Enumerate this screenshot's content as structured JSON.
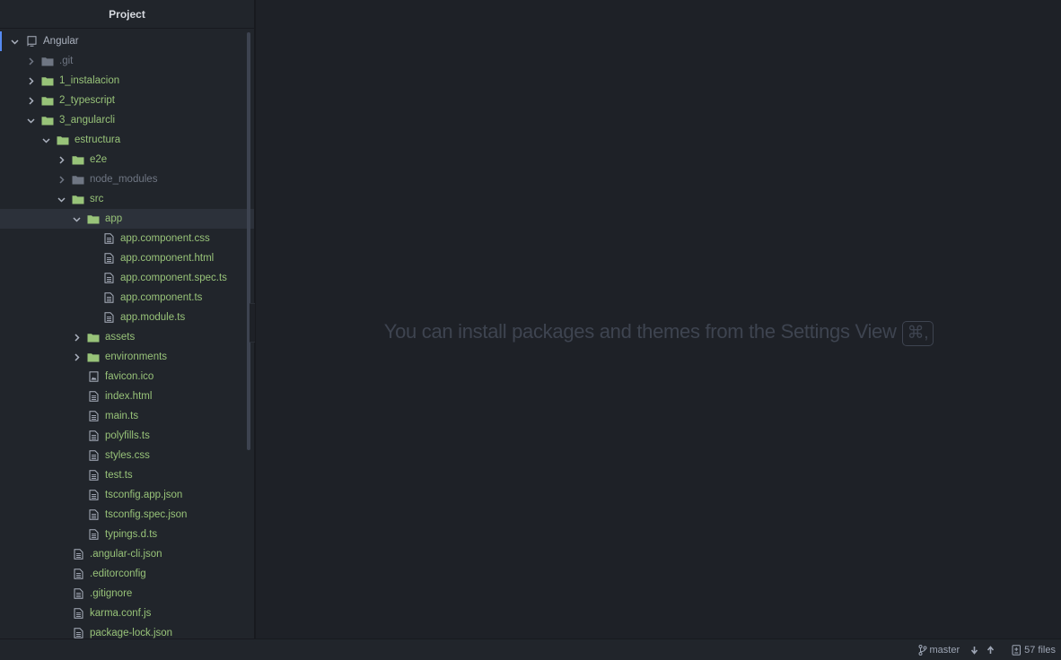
{
  "sidebar": {
    "title": "Project",
    "tree": [
      {
        "label": "Angular",
        "type": "project",
        "expanded": true,
        "depth": 0,
        "style": "root"
      },
      {
        "label": ".git",
        "type": "folder",
        "expanded": false,
        "depth": 1,
        "style": "dim"
      },
      {
        "label": "1_instalacion",
        "type": "folder",
        "expanded": false,
        "depth": 1,
        "style": "normal"
      },
      {
        "label": "2_typescript",
        "type": "folder",
        "expanded": false,
        "depth": 1,
        "style": "normal"
      },
      {
        "label": "3_angularcli",
        "type": "folder",
        "expanded": true,
        "depth": 1,
        "style": "normal"
      },
      {
        "label": "estructura",
        "type": "folder",
        "expanded": true,
        "depth": 2,
        "style": "normal"
      },
      {
        "label": "e2e",
        "type": "folder",
        "expanded": false,
        "depth": 3,
        "style": "normal"
      },
      {
        "label": "node_modules",
        "type": "folder",
        "expanded": false,
        "depth": 3,
        "style": "dim"
      },
      {
        "label": "src",
        "type": "folder",
        "expanded": true,
        "depth": 3,
        "style": "normal"
      },
      {
        "label": "app",
        "type": "folder",
        "expanded": true,
        "depth": 4,
        "style": "selected"
      },
      {
        "label": "app.component.css",
        "type": "file",
        "depth": 5,
        "style": "normal"
      },
      {
        "label": "app.component.html",
        "type": "file",
        "depth": 5,
        "style": "normal"
      },
      {
        "label": "app.component.spec.ts",
        "type": "file",
        "depth": 5,
        "style": "normal"
      },
      {
        "label": "app.component.ts",
        "type": "file",
        "depth": 5,
        "style": "normal"
      },
      {
        "label": "app.module.ts",
        "type": "file",
        "depth": 5,
        "style": "normal"
      },
      {
        "label": "assets",
        "type": "folder",
        "expanded": false,
        "depth": 4,
        "style": "normal"
      },
      {
        "label": "environments",
        "type": "folder",
        "expanded": false,
        "depth": 4,
        "style": "normal"
      },
      {
        "label": "favicon.ico",
        "type": "image",
        "depth": 4,
        "style": "normal"
      },
      {
        "label": "index.html",
        "type": "file",
        "depth": 4,
        "style": "normal"
      },
      {
        "label": "main.ts",
        "type": "file",
        "depth": 4,
        "style": "normal"
      },
      {
        "label": "polyfills.ts",
        "type": "file",
        "depth": 4,
        "style": "normal"
      },
      {
        "label": "styles.css",
        "type": "file",
        "depth": 4,
        "style": "normal"
      },
      {
        "label": "test.ts",
        "type": "file",
        "depth": 4,
        "style": "normal"
      },
      {
        "label": "tsconfig.app.json",
        "type": "file",
        "depth": 4,
        "style": "normal"
      },
      {
        "label": "tsconfig.spec.json",
        "type": "file",
        "depth": 4,
        "style": "normal"
      },
      {
        "label": "typings.d.ts",
        "type": "file",
        "depth": 4,
        "style": "normal"
      },
      {
        "label": ".angular-cli.json",
        "type": "file",
        "depth": 3,
        "style": "normal"
      },
      {
        "label": ".editorconfig",
        "type": "file",
        "depth": 3,
        "style": "normal"
      },
      {
        "label": ".gitignore",
        "type": "file",
        "depth": 3,
        "style": "normal"
      },
      {
        "label": "karma.conf.js",
        "type": "file",
        "depth": 3,
        "style": "normal"
      },
      {
        "label": "package-lock.json",
        "type": "file",
        "depth": 3,
        "style": "normal"
      }
    ]
  },
  "editor": {
    "welcome_text": "You can install packages and themes from the Settings View",
    "shortcut": "⌘,"
  },
  "statusbar": {
    "branch": "master",
    "files_count": "57 files"
  },
  "colors": {
    "background": "#1e2127",
    "sidebar": "#21252b",
    "git_new": "#98c379",
    "ignored": "#6f7683",
    "accent": "#568af2"
  }
}
